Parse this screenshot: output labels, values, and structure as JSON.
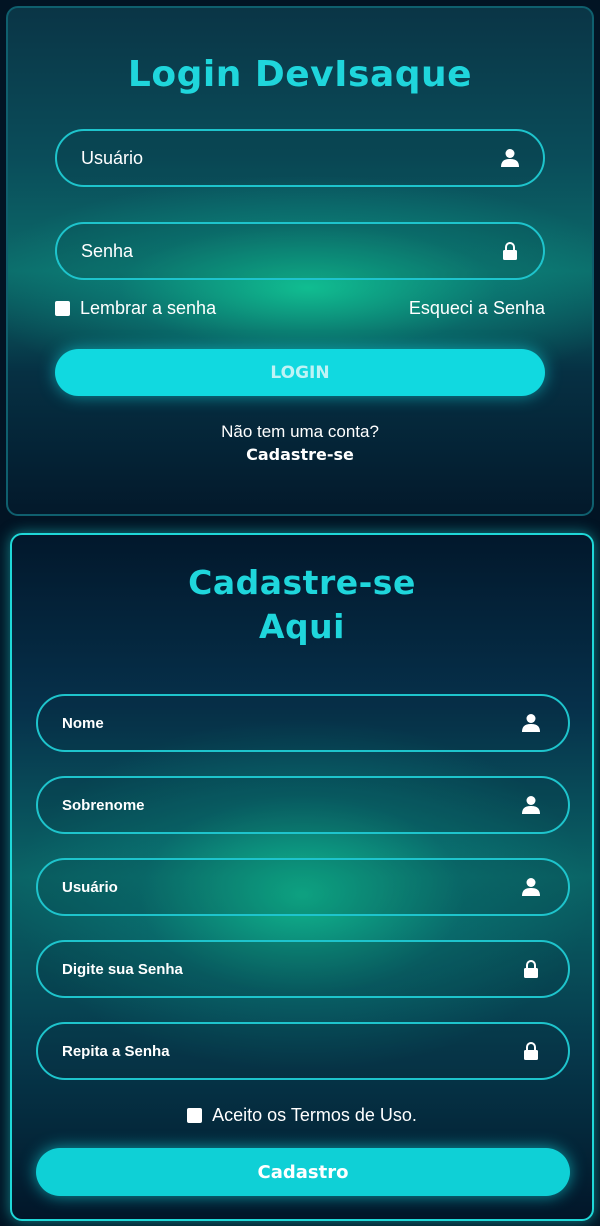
{
  "login": {
    "title": "Login DevIsaque",
    "username_placeholder": "Usuário",
    "password_placeholder": "Senha",
    "remember_label": "Lembrar a senha",
    "forgot_label": "Esqueci a Senha",
    "login_button": "LOGIN",
    "no_account_text": "Não tem uma conta?",
    "signup_link": "Cadastre-se"
  },
  "signup": {
    "title_line1": "Cadastre-se",
    "title_line2": "Aqui",
    "fields": [
      {
        "placeholder": "Nome",
        "icon": "user-icon"
      },
      {
        "placeholder": "Sobrenome",
        "icon": "user-icon"
      },
      {
        "placeholder": "Usuário",
        "icon": "user-icon"
      },
      {
        "placeholder": "Digite sua Senha",
        "icon": "lock-icon"
      },
      {
        "placeholder": "Repita a Senha",
        "icon": "lock-icon"
      }
    ],
    "terms_label": "Aceito os Termos de Uso.",
    "submit_button": "Cadastro"
  },
  "colors": {
    "accent": "#1fd6dc",
    "button": "#11d9e0",
    "background": "#021424"
  }
}
